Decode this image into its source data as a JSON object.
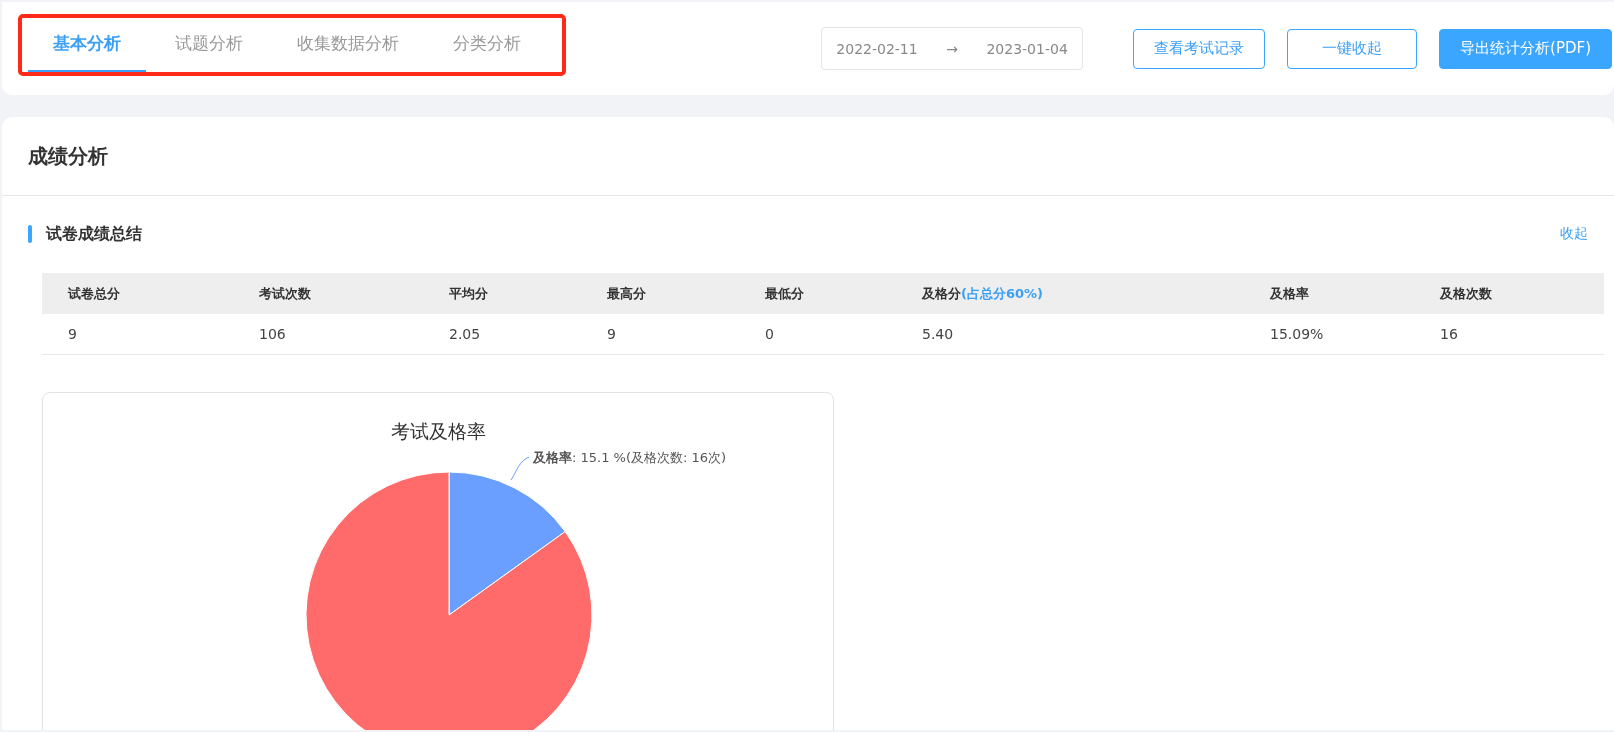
{
  "tabs": [
    {
      "label": "基本分析",
      "selected": true
    },
    {
      "label": "试题分析",
      "selected": false
    },
    {
      "label": "收集数据分析",
      "selected": false
    },
    {
      "label": "分类分析",
      "selected": false
    }
  ],
  "date_range": {
    "start": "2022-02-11",
    "separator": "→",
    "end": "2023-01-04"
  },
  "buttons": [
    {
      "label": "查看考试记录",
      "kind": "outline"
    },
    {
      "label": "一键收起",
      "kind": "outline"
    },
    {
      "label": "导出统计分析(PDF)",
      "kind": "primary"
    }
  ],
  "panel": {
    "title": "成绩分析",
    "section": {
      "title": "试卷成绩总结",
      "toggle": "收起",
      "table": {
        "columns": [
          {
            "label": "试卷总分"
          },
          {
            "label": "考试次数"
          },
          {
            "label": "平均分"
          },
          {
            "label": "最高分"
          },
          {
            "label": "最低分"
          },
          {
            "label": "及格分",
            "note": "(占总分60%)"
          },
          {
            "label": "及格率"
          },
          {
            "label": "及格次数"
          }
        ],
        "rows": [
          [
            "9",
            "106",
            "2.05",
            "9",
            "0",
            "5.40",
            "15.09%",
            "16"
          ]
        ]
      },
      "chart_data": {
        "type": "pie",
        "title": "考试及格率",
        "values": [
          15.09,
          84.91
        ],
        "colors": [
          "#6a9eff",
          "#ff6a6a"
        ],
        "annotations": [
          {
            "text": "**及格率**: 15.1 %(及格次数: 16次)"
          }
        ]
      }
    }
  }
}
